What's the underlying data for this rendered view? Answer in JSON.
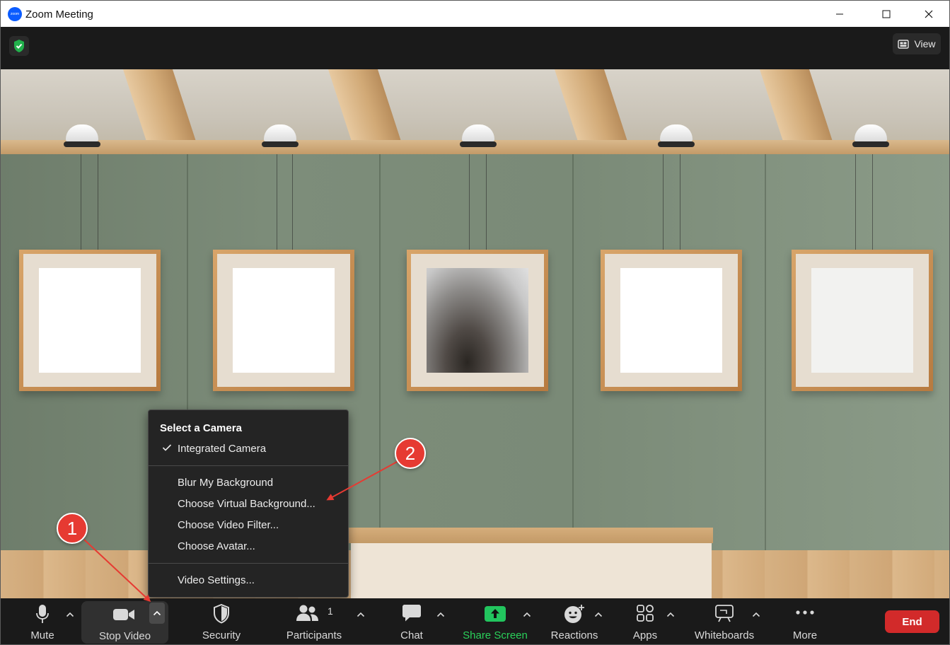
{
  "window": {
    "title": "Zoom Meeting",
    "logo_text": "zoom"
  },
  "header": {
    "view_label": "View"
  },
  "camera_menu": {
    "header": "Select a Camera",
    "camera_item": "Integrated Camera",
    "camera_selected": true,
    "items": [
      "Blur My Background",
      "Choose Virtual Background...",
      "Choose Video Filter...",
      "Choose Avatar..."
    ],
    "settings_item": "Video Settings..."
  },
  "annotations": {
    "marker_1": "1",
    "marker_2": "2",
    "color": "#e63a32"
  },
  "toolbar": {
    "mute": "Mute",
    "stop_video": "Stop Video",
    "security": "Security",
    "participants": "Participants",
    "participants_count": "1",
    "chat": "Chat",
    "share_screen": "Share Screen",
    "reactions": "Reactions",
    "apps": "Apps",
    "whiteboards": "Whiteboards",
    "more": "More",
    "end": "End",
    "share_color": "#2ad15a",
    "end_color": "#d22a2a"
  }
}
